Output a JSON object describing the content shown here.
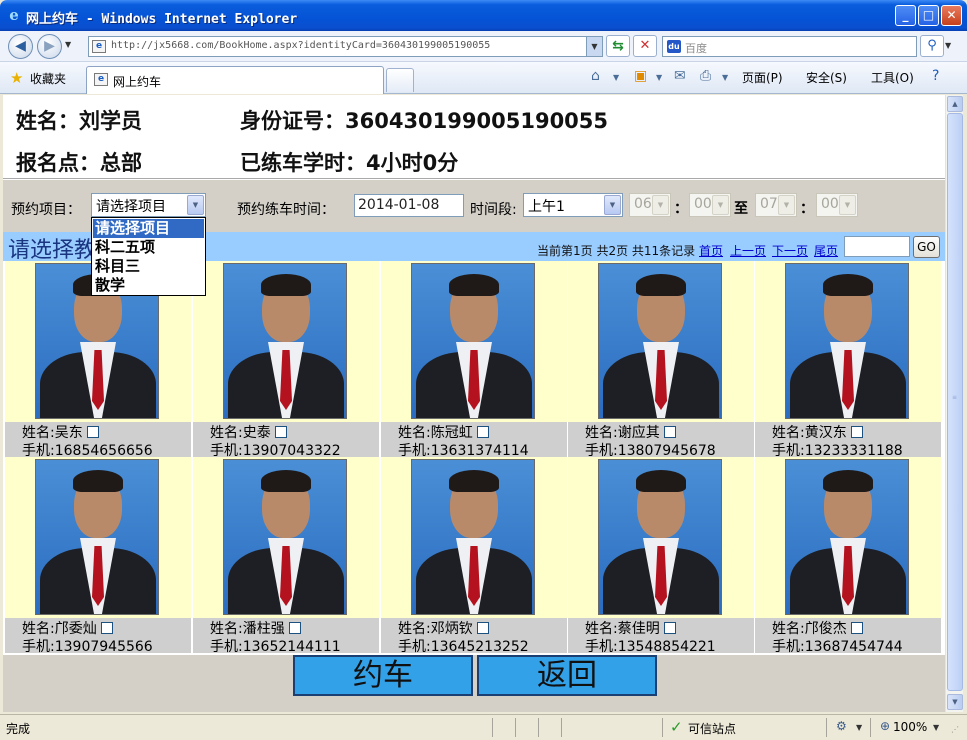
{
  "window": {
    "title": "网上约车 - Windows Internet Explorer"
  },
  "address_bar": {
    "url": "http://jx5668.com/BookHome.aspx?identityCard=360430199005190055",
    "search_placeholder": "百度"
  },
  "tabs": {
    "favorites_label": "收藏夹",
    "active_tab_label": "网上约车"
  },
  "command_bar": {
    "page_label": "页面(P)",
    "safety_label": "安全(S)",
    "tools_label": "工具(O)"
  },
  "student": {
    "name_line": "姓名：刘学员",
    "id_line": "身份证号：360430199005190055",
    "site_line": "报名点：总部",
    "hours_line": "已练车学时：4小时0分"
  },
  "booking": {
    "project_label": "预约项目：",
    "project_selected": "请选择项目",
    "project_options": [
      "请选择项目",
      "科二五项",
      "科目三",
      "散学"
    ],
    "time_label": "预约练车时间：",
    "date_value": "2014-01-08",
    "period_label": "时间段:",
    "period_value": "上午1",
    "start_hour": "06",
    "start_min": "00",
    "to_label": "至",
    "end_hour": "07",
    "end_min": "00",
    "colon": "："
  },
  "list": {
    "title": "请选择教练",
    "page_info": "当前第1页  共2页  共11条记录",
    "first": "首页",
    "prev": "上一页",
    "next": "下一页",
    "last": "尾页",
    "go": "GO"
  },
  "coaches": [
    {
      "name": "姓名:吴东",
      "phone": "手机:16854656656"
    },
    {
      "name": "姓名:史泰",
      "phone": "手机:13907043322"
    },
    {
      "name": "姓名:陈冠虹",
      "phone": "手机:13631374114"
    },
    {
      "name": "姓名:谢应其",
      "phone": "手机:13807945678"
    },
    {
      "name": "姓名:黄汉东",
      "phone": "手机:13233331188"
    },
    {
      "name": "姓名:邝委灿",
      "phone": "手机:13907945566"
    },
    {
      "name": "姓名:潘柱强",
      "phone": "手机:13652144111"
    },
    {
      "name": "姓名:邓炳钦",
      "phone": "手机:13645213252"
    },
    {
      "name": "姓名:蔡佳明",
      "phone": "手机:13548854221"
    },
    {
      "name": "姓名:邝俊杰",
      "phone": "手机:13687454744"
    }
  ],
  "actions": {
    "book": "约车",
    "back": "返回"
  },
  "status_bar": {
    "status": "完成",
    "zone": "可信站点",
    "zoom": "100%"
  }
}
